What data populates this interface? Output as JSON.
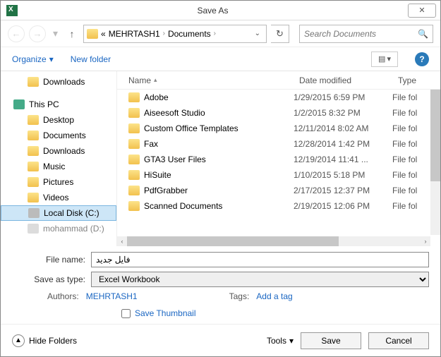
{
  "window": {
    "title": "Save As",
    "close_glyph": "✕"
  },
  "nav": {
    "back": "←",
    "fwd": "→",
    "up": "↑",
    "recent_dd": "▾",
    "path_prefix": "«",
    "seg1": "MEHRTASH1",
    "seg2": "Documents",
    "chev": "›",
    "refresh": "↻",
    "search_placeholder": "Search Documents",
    "mag": "🔍"
  },
  "toolbar": {
    "organize": "Organize",
    "org_dd": "▾",
    "new_folder": "New folder",
    "view_glyph": "▤",
    "view_dd": "▾",
    "help": "?"
  },
  "tree": [
    {
      "name": "Downloads",
      "kind": "folder",
      "indent": true
    },
    {
      "name": "",
      "kind": "gap"
    },
    {
      "name": "This PC",
      "kind": "pc",
      "indent": false
    },
    {
      "name": "Desktop",
      "kind": "folder",
      "indent": true
    },
    {
      "name": "Documents",
      "kind": "folder",
      "indent": true
    },
    {
      "name": "Downloads",
      "kind": "folder",
      "indent": true
    },
    {
      "name": "Music",
      "kind": "folder",
      "indent": true
    },
    {
      "name": "Pictures",
      "kind": "folder",
      "indent": true
    },
    {
      "name": "Videos",
      "kind": "folder",
      "indent": true
    },
    {
      "name": "Local Disk (C:)",
      "kind": "disk",
      "indent": true,
      "sel": true
    },
    {
      "name": "mohammad (D:)",
      "kind": "disk",
      "indent": true,
      "dim": true
    }
  ],
  "cols": {
    "name": "Name",
    "date": "Date modified",
    "type": "Type",
    "sort": "▴"
  },
  "rows": [
    {
      "name": "Adobe",
      "date": "1/29/2015 6:59 PM",
      "type": "File fol"
    },
    {
      "name": "Aiseesoft Studio",
      "date": "1/2/2015 8:32 PM",
      "type": "File fol"
    },
    {
      "name": "Custom Office Templates",
      "date": "12/11/2014 8:02 AM",
      "type": "File fol"
    },
    {
      "name": "Fax",
      "date": "12/28/2014 1:42 PM",
      "type": "File fol"
    },
    {
      "name": "GTA3 User Files",
      "date": "12/19/2014 11:41 ...",
      "type": "File fol"
    },
    {
      "name": "HiSuite",
      "date": "1/10/2015 5:18 PM",
      "type": "File fol"
    },
    {
      "name": "PdfGrabber",
      "date": "2/17/2015 12:37 PM",
      "type": "File fol"
    },
    {
      "name": "Scanned Documents",
      "date": "2/19/2015 12:06 PM",
      "type": "File fol"
    }
  ],
  "form": {
    "filename_label": "File name:",
    "filename_value": "فایل جدید",
    "type_label": "Save as type:",
    "type_value": "Excel Workbook",
    "authors_label": "Authors:",
    "authors_value": "MEHRTASH1",
    "tags_label": "Tags:",
    "tags_value": "Add a tag",
    "save_thumb": "Save Thumbnail"
  },
  "footer": {
    "hide": "Hide Folders",
    "hide_glyph": "▲",
    "tools": "Tools",
    "tools_dd": "▾",
    "save": "Save",
    "cancel": "Cancel"
  },
  "scroll": {
    "left": "‹",
    "right": "›"
  }
}
